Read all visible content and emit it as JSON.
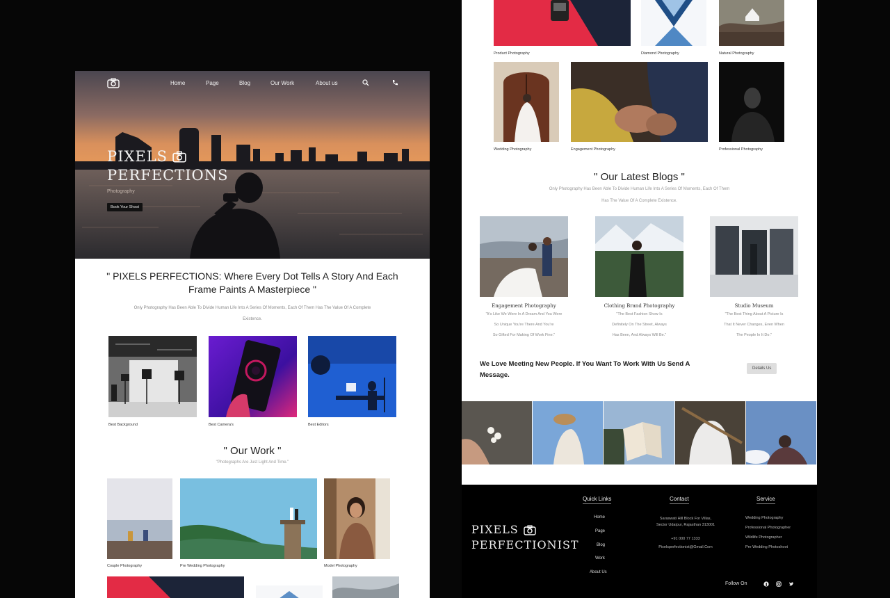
{
  "colors": {
    "page_bg": "#060606",
    "accent_red": "#e32b45",
    "dark_footer": "#000000",
    "button_dark": "#111111",
    "button_light": "#dedede"
  },
  "left": {
    "nav": {
      "logo_icon": "camera-icon",
      "items": [
        "Home",
        "Page",
        "Blog",
        "Our Work",
        "About us"
      ],
      "search_icon": "search-icon",
      "phone_icon": "phone-icon"
    },
    "hero": {
      "title_line1": "PIXELS",
      "title_line2": "PERFECTIONS",
      "subtitle": "Photography",
      "button": "Book Your Shoot"
    },
    "tagline": {
      "text": "\" PIXELS PERFECTIONS: Where Every Dot Tells A Story And Each Frame Paints A Masterpiece \"",
      "description": "Only Photography Has Been Able To Divide Human Life Into A Series Of Moments, Each Of Them Has The Value Of A Complete Existence."
    },
    "categories": [
      {
        "caption": "Best Background"
      },
      {
        "caption": "Best Camera's"
      },
      {
        "caption": "Best Editors"
      }
    ],
    "our_work": {
      "heading": "\" Our Work \"",
      "subheading": "\"Photographs Are Just Light And Time.\"",
      "items": [
        {
          "caption": "Couple Photography"
        },
        {
          "caption": "Pre Wedding Photography"
        },
        {
          "caption": "Model Photography"
        }
      ]
    }
  },
  "right": {
    "top_row": [
      {
        "caption": "Product Photography"
      },
      {
        "caption": "Diamond Photography"
      },
      {
        "caption": "Natural Photography"
      }
    ],
    "second_row": [
      {
        "caption": "Wedding Photography"
      },
      {
        "caption": "Engagement Photography"
      },
      {
        "caption": "Professional Photography"
      }
    ],
    "blogs": {
      "heading": "\" Our Latest Blogs \"",
      "description_line1": "Only Photography Has Been Able To Divide Human Life Into A Series Of Moments, Each Of Them",
      "description_line2": "Has The Value Of A Complete Existence.",
      "cards": [
        {
          "title": "Engagement Photography",
          "desc": [
            "\"It's Like We Were In A Dream And You Were",
            "So Unique You're There And You're",
            "So Gifted For Making Of Work Fine.\""
          ]
        },
        {
          "title": "Clothing Brand Photography",
          "desc": [
            "\"The Best Fashion Show Is",
            "Definitely On The Street, Always",
            "Has Been, And Always Will Be.\""
          ]
        },
        {
          "title": "Studio Museum",
          "desc": [
            "\"The Best Thing About A Picture Is",
            "That It Never Changes, Even When",
            "The People In It Do.\""
          ]
        }
      ]
    },
    "cta": {
      "text": "We Love Meeting New People. If You Want To Work With Us Send A Message.",
      "button": "Details Us"
    },
    "strip_count": 5
  },
  "footer": {
    "brand_line1": "PIXELS",
    "brand_line2": "PERFECTIONIST",
    "quick_links": {
      "heading": "Quick Links",
      "items": [
        "Home",
        "Page",
        "Blog",
        "Work",
        "About Us"
      ]
    },
    "contact": {
      "heading": "Contact",
      "lines": [
        "Saraswati Hill Block For Villas,",
        "Sector Udaipur, Rajasthan 313001",
        "+91 000 77 1333",
        "Pixelsperfectionist@Gmail.Com"
      ]
    },
    "service": {
      "heading": "Service",
      "items": [
        "Wedding Photography",
        "Professional Photographer",
        "Wildlife Photographer",
        "Pre Wedding Photoshoot"
      ]
    },
    "follow": "Follow On",
    "social_icons": [
      "facebook-icon",
      "instagram-icon",
      "twitter-icon"
    ]
  }
}
